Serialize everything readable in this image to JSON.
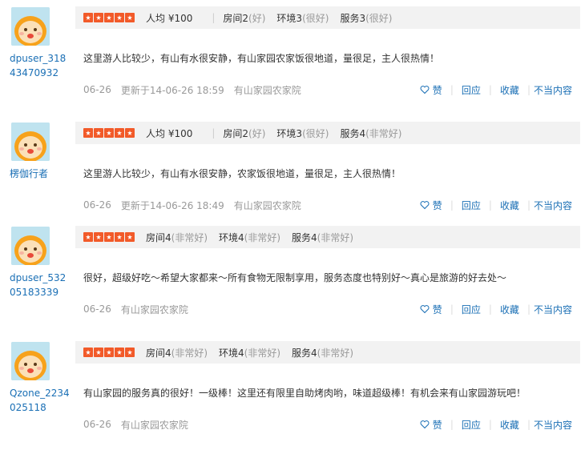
{
  "colors": {
    "star": "#f25a29",
    "link": "#1a6fb5",
    "muted": "#999999",
    "meta_bg": "#f2f2f2"
  },
  "icons": {
    "avatar": "cartoon-face-avatar-icon",
    "like": "heart-outline-icon",
    "star": "star-icon"
  },
  "actions": {
    "like": "赞",
    "reply": "回应",
    "favorite": "收藏",
    "report": "不当内容"
  },
  "reviews": [
    {
      "username": "dpuser_31843470932",
      "username_line1": "dpuser_318",
      "username_line2": "43470932",
      "stars": 5,
      "price": "人均 ¥100",
      "scores": [
        {
          "label": "房间2",
          "desc": "(好)"
        },
        {
          "label": "环境3",
          "desc": "(很好)"
        },
        {
          "label": "服务3",
          "desc": "(很好)"
        }
      ],
      "content": "这里游人比较少，有山有水很安静，有山家园农家饭很地道，量很足，主人很热情！",
      "date": "06-26",
      "updated": "更新于14-06-26 18:59",
      "shop": "有山家园农家院"
    },
    {
      "username": "楞伽行者",
      "username_line1": "楞伽行者",
      "username_line2": "",
      "stars": 5,
      "price": "人均 ¥100",
      "scores": [
        {
          "label": "房间2",
          "desc": "(好)"
        },
        {
          "label": "环境3",
          "desc": "(很好)"
        },
        {
          "label": "服务4",
          "desc": "(非常好)"
        }
      ],
      "content": "这里游人比较少，有山有水很安静，农家饭很地道，量很足，主人很热情！",
      "date": "06-26",
      "updated": "更新于14-06-26 18:49",
      "shop": "有山家园农家院"
    },
    {
      "username": "dpuser_53205183339",
      "username_line1": "dpuser_532",
      "username_line2": "05183339",
      "stars": 5,
      "price": "",
      "scores": [
        {
          "label": "房间4",
          "desc": "(非常好)"
        },
        {
          "label": "环境4",
          "desc": "(非常好)"
        },
        {
          "label": "服务4",
          "desc": "(非常好)"
        }
      ],
      "content": "很好，超级好吃～希望大家都来～所有食物无限制享用，服务态度也特别好～真心是旅游的好去处～",
      "date": "06-26",
      "updated": "",
      "shop": "有山家园农家院"
    },
    {
      "username": "Qzone_2234025118",
      "username_line1": "Qzone_2234",
      "username_line2": "025118",
      "stars": 5,
      "price": "",
      "scores": [
        {
          "label": "房间4",
          "desc": "(非常好)"
        },
        {
          "label": "环境4",
          "desc": "(非常好)"
        },
        {
          "label": "服务4",
          "desc": "(非常好)"
        }
      ],
      "content": "有山家园的服务真的很好！一级棒！这里还有限里自助烤肉哟，味道超级棒！有机会来有山家园游玩吧！",
      "date": "06-26",
      "updated": "",
      "shop": "有山家园农家院"
    }
  ]
}
